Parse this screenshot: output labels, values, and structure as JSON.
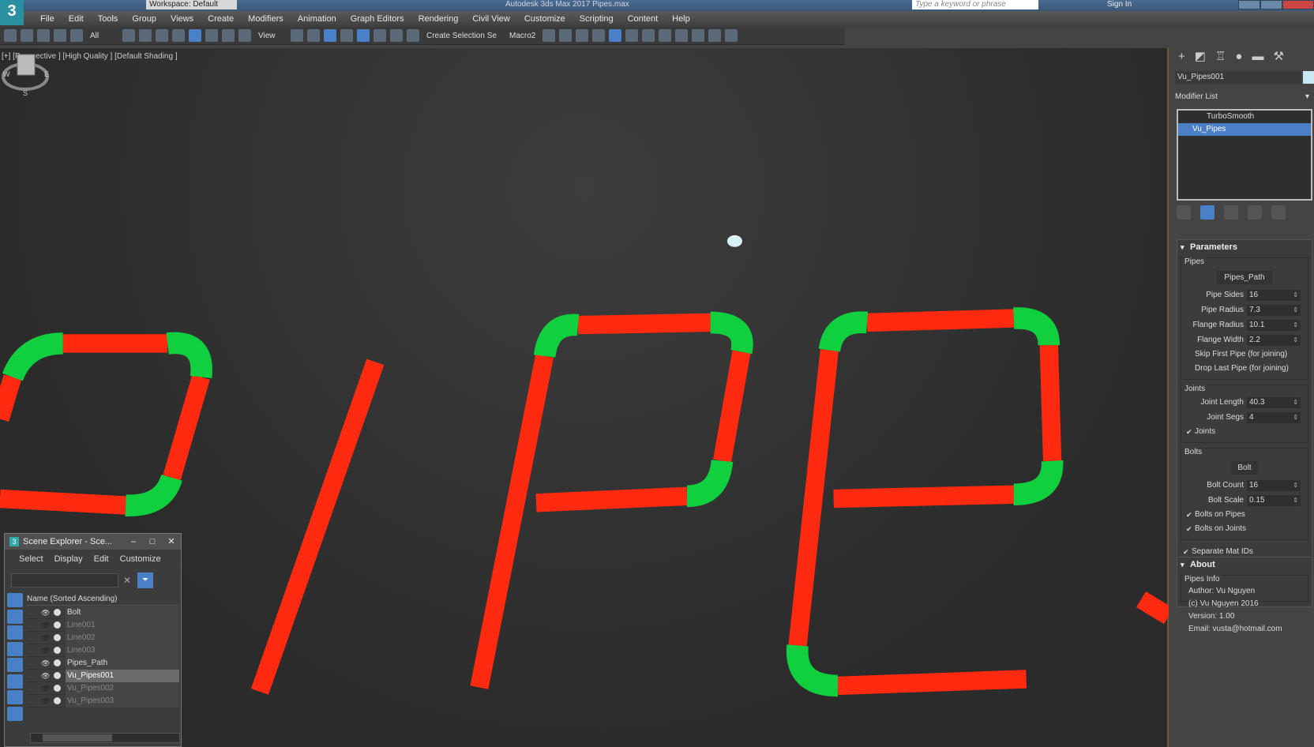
{
  "app": {
    "title": "Autodesk 3ds Max 2017    Pipes.max",
    "workspace": "Workspace: Default",
    "search_placeholder": "Type a keyword or phrase",
    "sign_in": "Sign In",
    "logo": "3"
  },
  "menu": [
    "File",
    "Edit",
    "Tools",
    "Group",
    "Views",
    "Create",
    "Modifiers",
    "Animation",
    "Graph Editors",
    "Rendering",
    "Civil View",
    "Customize",
    "Scripting",
    "Content",
    "Help"
  ],
  "toolbar": {
    "selection_filter": "All",
    "ref_coord": "View",
    "named_selection": "Create Selection Se",
    "macro": "Macro2"
  },
  "viewport": {
    "label": "[+] [Perspective ] [High Quality ] [Default Shading ]",
    "pipe_color": "#ff2a10",
    "joint_color": "#10d040",
    "viewcube": {
      "w": "W",
      "e": "E",
      "s": "S"
    }
  },
  "command_panel": {
    "object_name": "Vu_Pipes001",
    "object_color": "#c8e8f4",
    "modifier_list": "Modifier List",
    "stack": [
      {
        "label": "TurboSmooth",
        "selected": false
      },
      {
        "label": "Vu_Pipes",
        "selected": true
      }
    ],
    "parameters": {
      "title": "Parameters",
      "pipes": {
        "label": "Pipes",
        "path_button": "Pipes_Path",
        "fields": [
          {
            "label": "Pipe Sides",
            "value": "16"
          },
          {
            "label": "Pipe Radius",
            "value": "7.3"
          },
          {
            "label": "Flange Radius",
            "value": "10.1"
          },
          {
            "label": "Flange Width",
            "value": "2.2"
          }
        ],
        "checks": [
          {
            "label": "Skip First Pipe (for joining)",
            "checked": false
          },
          {
            "label": "Drop Last Pipe (for joining)",
            "checked": false
          }
        ]
      },
      "joints": {
        "label": "Joints",
        "fields": [
          {
            "label": "Joint Length",
            "value": "40.3"
          },
          {
            "label": "Joint Segs",
            "value": "4"
          }
        ],
        "checks": [
          {
            "label": "Joints",
            "checked": true
          }
        ]
      },
      "bolts": {
        "label": "Bolts",
        "bolt_button": "Bolt",
        "fields": [
          {
            "label": "Bolt Count",
            "value": "16"
          },
          {
            "label": "Bolt Scale",
            "value": "0.15"
          }
        ],
        "checks": [
          {
            "label": "Bolts on Pipes",
            "checked": true
          },
          {
            "label": "Bolts on Joints",
            "checked": true
          }
        ]
      },
      "separate": {
        "label": "Separate Mat IDs",
        "checked": true
      }
    },
    "about": {
      "title": "About",
      "group": "Pipes Info",
      "lines": [
        "Author: Vu Nguyen",
        "(c) Vu Nguyen 2016",
        "Version: 1.00",
        "Email: vusta@hotmail.com"
      ]
    }
  },
  "scene_explorer": {
    "title": "Scene Explorer - Sce...",
    "menu": [
      "Select",
      "Display",
      "Edit",
      "Customize"
    ],
    "column": "Name (Sorted Ascending)",
    "items": [
      {
        "name": "Bolt",
        "visible": true,
        "selected": false
      },
      {
        "name": "Line001",
        "visible": false,
        "selected": false
      },
      {
        "name": "Line002",
        "visible": false,
        "selected": false
      },
      {
        "name": "Line003",
        "visible": false,
        "selected": false
      },
      {
        "name": "Pipes_Path",
        "visible": true,
        "selected": false
      },
      {
        "name": "Vu_Pipes001",
        "visible": true,
        "selected": true
      },
      {
        "name": "Vu_Pipes002",
        "visible": false,
        "selected": false
      },
      {
        "name": "Vu_Pipes003",
        "visible": false,
        "selected": false
      }
    ]
  }
}
